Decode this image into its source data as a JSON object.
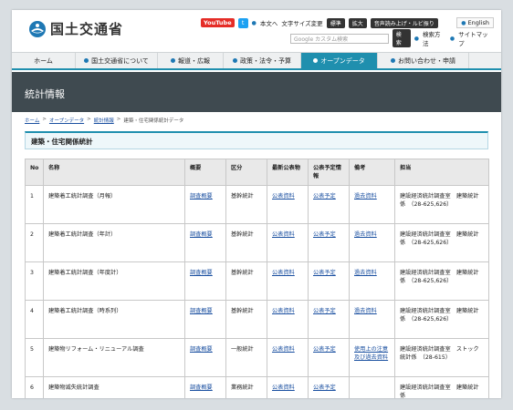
{
  "header": {
    "logo_text": "国土交通省",
    "youtube": "YouTube",
    "text_only": "本文へ",
    "font_size_label": "文字サイズ変更",
    "font_standard": "標準",
    "font_large": "拡大",
    "read_aloud": "音声読み上げ・ルビ振り",
    "english": "English",
    "search_placeholder": "Google カスタム検索",
    "search_button": "検索",
    "search_method": "検索方法",
    "sitemap": "サイトマップ"
  },
  "nav": {
    "items": [
      {
        "label": "ホーム"
      },
      {
        "label": "国土交通省について"
      },
      {
        "label": "報道・広報"
      },
      {
        "label": "政策・法令・予算"
      },
      {
        "label": "オープンデータ"
      },
      {
        "label": "お問い合わせ・申請"
      }
    ]
  },
  "banner": {
    "title": "統計情報"
  },
  "breadcrumb": {
    "items": [
      "ホーム",
      "オープンデータ",
      "統計情報"
    ],
    "current": "建築・住宅関係統計データ",
    "separator": ">"
  },
  "section": {
    "title": "建築・住宅関係統計"
  },
  "table": {
    "headers": [
      "No",
      "名称",
      "概要",
      "区分",
      "最新公表物",
      "公表予定情報",
      "備考",
      "担当"
    ],
    "rows": [
      {
        "no": "1",
        "name": "建築着工統計調査（月報）",
        "summary": "調査概要",
        "category": "基幹統計",
        "latest": "公表資料",
        "schedule": "公表予定",
        "note": "過去資料",
        "contact": "建設経済統計調査室　建築統計係　（28-625,626）"
      },
      {
        "no": "2",
        "name": "建築着工統計調査（年計）",
        "summary": "調査概要",
        "category": "基幹統計",
        "latest": "公表資料",
        "schedule": "公表予定",
        "note": "過去資料",
        "contact": "建設経済統計調査室　建築統計係　（28-625,626）"
      },
      {
        "no": "3",
        "name": "建築着工統計調査（年度計）",
        "summary": "調査概要",
        "category": "基幹統計",
        "latest": "公表資料",
        "schedule": "公表予定",
        "note": "過去資料",
        "contact": "建設経済統計調査室　建築統計係　（28-625,626）"
      },
      {
        "no": "4",
        "name": "建築着工統計調査（時系列）",
        "summary": "調査概要",
        "category": "基幹統計",
        "latest": "公表資料",
        "schedule": "公表予定",
        "note": "過去資料",
        "contact": "建設経済統計調査室　建築統計係　（28-625,626）"
      },
      {
        "no": "5",
        "name": "建築物リフォーム・リニューアル調査",
        "summary": "調査概要",
        "category": "一般統計",
        "latest": "公表資料",
        "schedule": "公表予定",
        "note": "使用上の注意及び過去資料",
        "contact": "建設経済統計調査室　ストック統計係　（28-615）"
      },
      {
        "no": "6",
        "name": "建築物滅失統計調査",
        "summary": "調査概要",
        "category": "業務統計",
        "latest": "公表資料",
        "schedule": "公表予定",
        "note": "",
        "contact": "建設経済統計調査室　建築統計係"
      }
    ]
  },
  "colors": {
    "accent": "#1f8fae",
    "banner": "#3f4a50",
    "link": "#1a4fa0"
  }
}
